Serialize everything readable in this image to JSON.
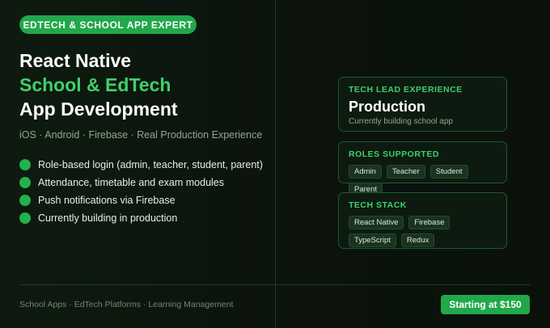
{
  "badge": "EDTECH & SCHOOL APP EXPERT",
  "title": {
    "line1": "React Native",
    "line2": "School & EdTech",
    "line3": "App Development"
  },
  "subtitle": "iOS · Android · Firebase · Real Production Experience",
  "features": [
    "Role-based login (admin, teacher, student, parent)",
    "Attendance, timetable and exam modules",
    "Push notifications via Firebase",
    "Currently building in production"
  ],
  "cards": {
    "tech_lead": {
      "label": "TECH LEAD EXPERIENCE",
      "value": "Production",
      "sub": "Currently building school app"
    },
    "roles": {
      "label": "ROLES SUPPORTED",
      "tags": [
        "Admin",
        "Teacher",
        "Student",
        "Parent"
      ]
    },
    "stack": {
      "label": "TECH STACK",
      "tags": [
        "React Native",
        "Firebase",
        "TypeScript",
        "Redux"
      ]
    }
  },
  "footer": {
    "text": "School Apps · EdTech Platforms · Learning Management",
    "price": "Starting at $150"
  },
  "colors": {
    "accent": "#21a84a",
    "accent_text": "#3fd06b",
    "background": "#0c140e"
  }
}
